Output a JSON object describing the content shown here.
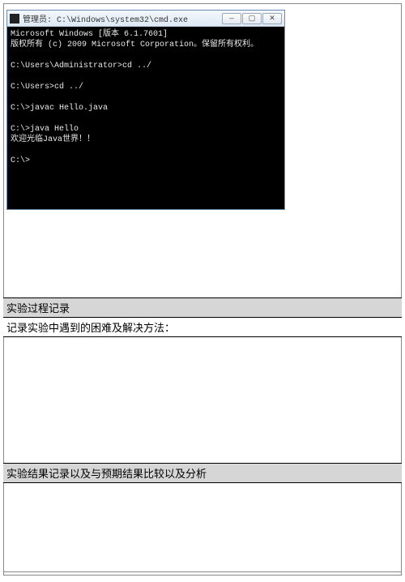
{
  "window": {
    "title": "管理员: C:\\Windows\\system32\\cmd.exe",
    "controls": {
      "min": "—",
      "max": "▢",
      "close": "✕"
    }
  },
  "terminal": {
    "lines": [
      "Microsoft Windows [版本 6.1.7601]",
      "版权所有 (c) 2009 Microsoft Corporation。保留所有权利。",
      "",
      "C:\\Users\\Administrator>cd ../",
      "",
      "C:\\Users>cd ../",
      "",
      "C:\\>javac Hello.java",
      "",
      "C:\\>java Hello",
      "欢迎光临Java世界！！",
      "",
      "C:\\>"
    ]
  },
  "sections": {
    "process_title": "实验过程记录",
    "process_sub": "记录实验中遇到的困难及解决方法：",
    "result_title": "实验结果记录以及与预期结果比较以及分析"
  }
}
